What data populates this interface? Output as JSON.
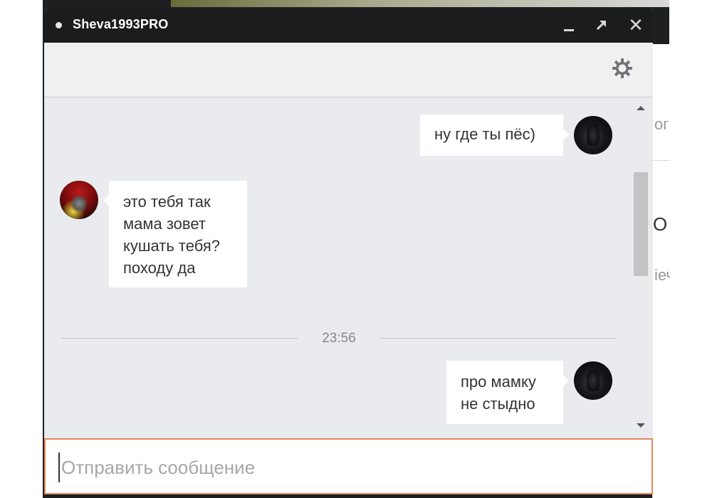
{
  "window": {
    "title": "Sheva1993PRO",
    "status": "online"
  },
  "titlebar_buttons": {
    "minimize": "minimize-icon",
    "popout": "popout-icon",
    "close_glyph": "✕"
  },
  "toolbar": {
    "settings_icon": "gear-icon"
  },
  "messages": [
    {
      "side": "right",
      "lines": [
        "ну где ты пёс)"
      ]
    },
    {
      "side": "left",
      "lines": [
        "это тебя так",
        "мама зовет",
        "кушать тебя?",
        "походу да"
      ]
    },
    {
      "side": "right",
      "lines": [
        "про мамку",
        "не стыдно"
      ]
    }
  ],
  "divider": {
    "time": "23:56"
  },
  "composer": {
    "placeholder": "Отправить сообщение",
    "value": ""
  },
  "background": {
    "fragment_1": "ог",
    "fragment_2": "О",
    "fragment_3": "іеч"
  },
  "colors": {
    "titlebar": "#1b1c1e",
    "chat_bg": "#e9ebee",
    "bubble": "#ffffff",
    "composer_border": "#e8855a"
  }
}
